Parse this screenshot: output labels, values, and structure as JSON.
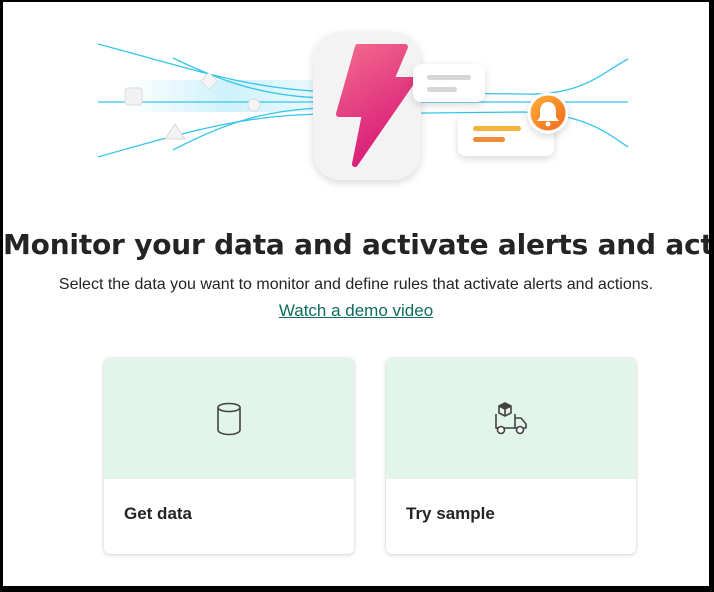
{
  "page": {
    "title": "Monitor your data and activate alerts and actions",
    "subtitle": "Select the data you want to monitor and define rules that activate alerts and actions.",
    "demo_link": "Watch a demo video"
  },
  "cards": [
    {
      "label": "Get data",
      "icon": "database-icon"
    },
    {
      "label": "Try sample",
      "icon": "delivery-truck-icon"
    }
  ],
  "colors": {
    "card_top": "#e1f5ea",
    "link": "#0f6b5e",
    "lightning_pink": "#e8467c",
    "bell_orange": "#f47a1f",
    "flow_lines": "#36c5ea"
  }
}
